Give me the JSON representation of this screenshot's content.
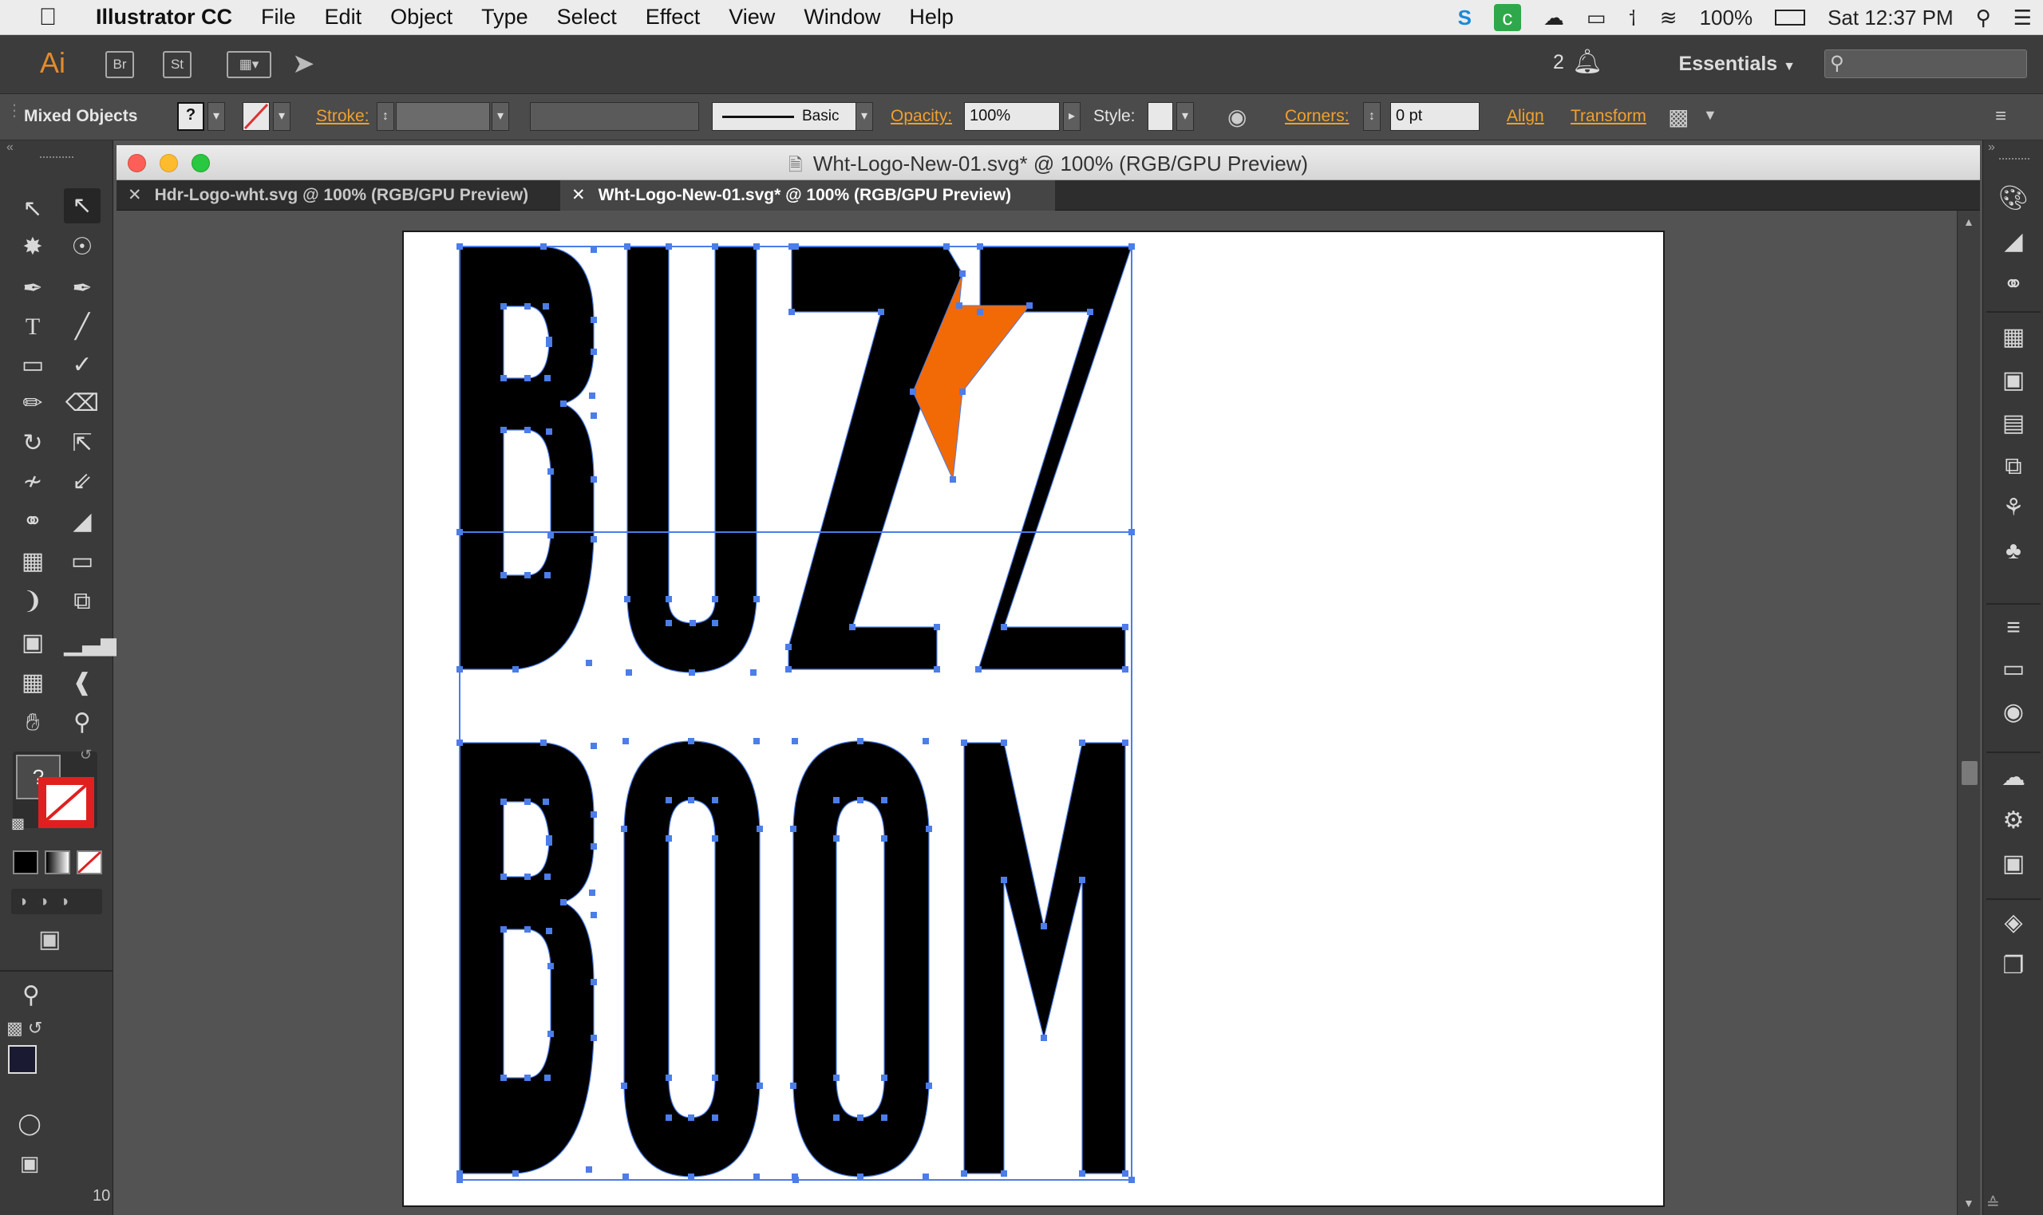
{
  "menubar": {
    "apple": "",
    "items": [
      "Illustrator CC",
      "File",
      "Edit",
      "Object",
      "Type",
      "Select",
      "Effect",
      "View",
      "Window",
      "Help"
    ],
    "battery": "100%",
    "clock": "Sat 12:37 PM"
  },
  "appbar": {
    "logo": "Ai",
    "bridge": "Br",
    "stock": "St",
    "notifications_count": "2",
    "workspace": "Essentials"
  },
  "controlbar": {
    "selection": "Mixed Objects",
    "fill_value": "?",
    "stroke_label": "Stroke:",
    "brush_label": "Basic",
    "opacity_label": "Opacity:",
    "opacity_value": "100%",
    "style_label": "Style:",
    "corners_label": "Corners:",
    "corners_value": "0 pt",
    "align_label": "Align",
    "transform_label": "Transform"
  },
  "document": {
    "window_title": "Wht-Logo-New-01.svg* @ 100% (RGB/GPU Preview)",
    "tabs": [
      {
        "label": "Hdr-Logo-wht.svg @ 100% (RGB/GPU Preview)",
        "active": false
      },
      {
        "label": "Wht-Logo-New-01.svg* @ 100% (RGB/GPU Preview)",
        "active": true
      }
    ],
    "zoom_partial": "10"
  },
  "artwork": {
    "line1": "BUZZ",
    "line2": "BOOM",
    "letter_color": "#000000",
    "bolt_color": "#f26a05",
    "selection_color": "#4c7de8"
  },
  "toolbar": {
    "fill_swatch": "?"
  }
}
